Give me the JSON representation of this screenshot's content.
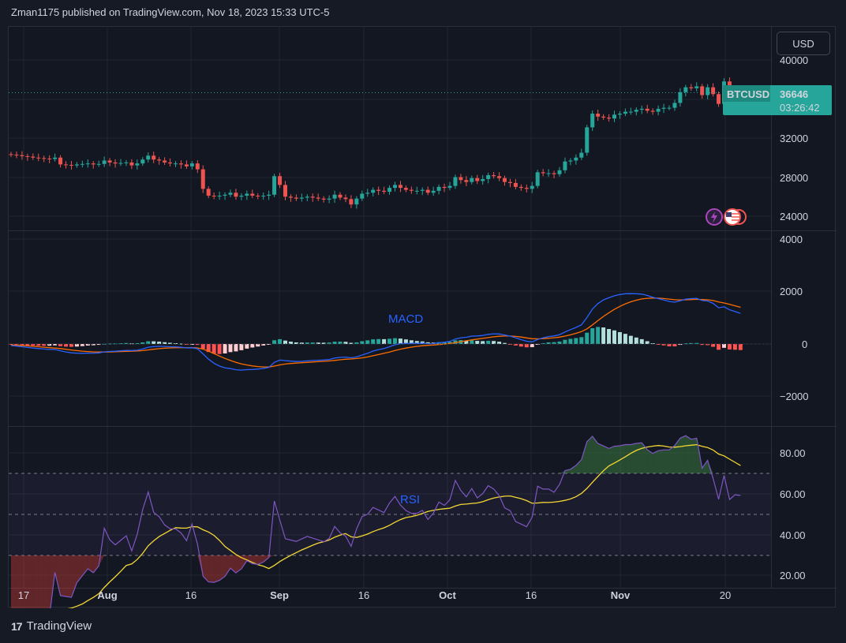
{
  "header": {
    "attribution": "Zman1175 published on TradingView.com, Nov 18, 2023 15:33 UTC-5"
  },
  "currency_button": "USD",
  "footer": {
    "brand": "TradingView",
    "mark": "17"
  },
  "colors": {
    "up": "#26a69a",
    "down": "#ef5350",
    "macd_line": "#2962ff",
    "signal_line": "#ff6d00",
    "rsi_line": "#7e57c2",
    "rsi_ma": "#f5d833",
    "grid": "#22262f",
    "text": "#d1d4dc"
  },
  "chart_data": [
    {
      "type": "candlestick",
      "symbol_label": "BTCUSD",
      "last_price": "36646",
      "countdown": "03:26:42",
      "y_ticks": [
        "40000",
        "32000",
        "28000",
        "24000"
      ],
      "x_ticks": [
        "17",
        "Aug",
        "16",
        "Sep",
        "16",
        "Oct",
        "16",
        "Nov",
        "20"
      ],
      "ylim": [
        22500,
        41300
      ],
      "x_dates": "Jul 14 2023 - Nov 18 2023, daily",
      "close": [
        30300,
        30250,
        30150,
        30100,
        30000,
        29950,
        29900,
        29850,
        30000,
        29300,
        29250,
        29200,
        29300,
        29350,
        29400,
        29300,
        29350,
        29700,
        29500,
        29400,
        29450,
        29500,
        29200,
        29400,
        29800,
        30200,
        29800,
        29700,
        29500,
        29400,
        29400,
        29300,
        29100,
        29400,
        28800,
        26800,
        26100,
        26050,
        26100,
        26200,
        26400,
        26000,
        26100,
        26300,
        26100,
        26050,
        26100,
        26200,
        28100,
        27200,
        26000,
        25900,
        25800,
        25900,
        26000,
        25900,
        25800,
        25700,
        25800,
        26200,
        25900,
        25750,
        25200,
        25800,
        26300,
        26400,
        26700,
        26600,
        26500,
        26900,
        27200,
        26900,
        26700,
        26600,
        26600,
        26700,
        26400,
        26600,
        27000,
        26900,
        27100,
        28000,
        27700,
        27500,
        27900,
        27600,
        27800,
        28200,
        28100,
        27900,
        27500,
        27400,
        27000,
        26900,
        26800,
        27100,
        28500,
        28400,
        28400,
        28300,
        28700,
        29600,
        29700,
        30000,
        30500,
        33100,
        34500,
        34200,
        34100,
        34000,
        34400,
        34500,
        34700,
        34700,
        34900,
        35000,
        34800,
        34700,
        35000,
        35100,
        35100,
        35600,
        36700,
        37200,
        37100,
        37300,
        36400,
        37200,
        36500,
        35500,
        37800,
        36200,
        36700,
        36650
      ]
    },
    {
      "type": "macd",
      "label": "MACD",
      "y_ticks": [
        "4000",
        "2000",
        "0",
        "−2000"
      ],
      "ylim": [
        -3250,
        4000
      ]
    },
    {
      "type": "rsi",
      "label": "RSI",
      "y_ticks": [
        "80.00",
        "60.00",
        "40.00",
        "20.00"
      ],
      "ylim": [
        16,
        96
      ],
      "bands": [
        70,
        50,
        30
      ]
    }
  ]
}
